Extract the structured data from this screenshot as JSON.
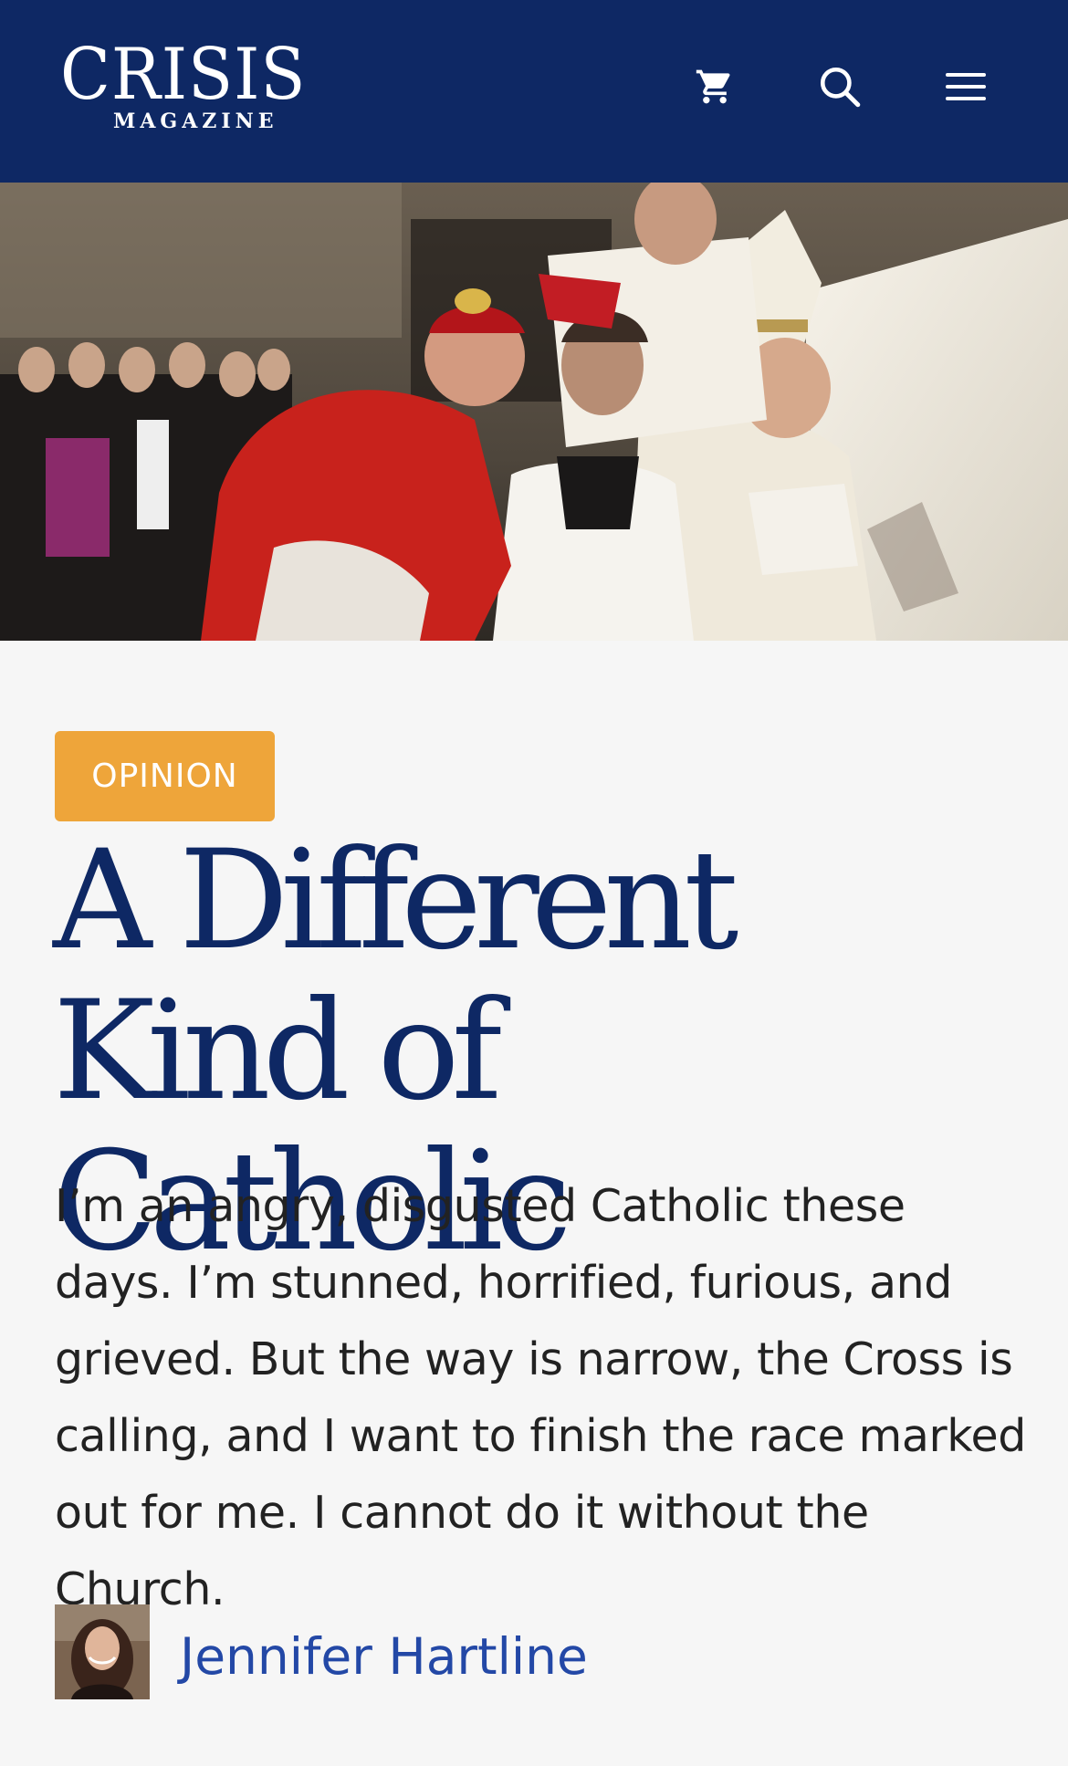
{
  "site": {
    "logo_main": "CRISIS",
    "logo_sub": "MAGAZINE",
    "brand_color": "#0e2864"
  },
  "nav": {
    "icons": [
      "cart-icon",
      "search-icon",
      "menu-icon"
    ]
  },
  "hero": {
    "icon": "hero-image"
  },
  "article": {
    "category": "OPINION",
    "category_color": "#eea53a",
    "title": "A Different Kind of Catholic",
    "excerpt": "I’m an angry, disgusted Catholic these days. I’m stunned, horrified, furious, and grieved. But the way is narrow, the Cross is calling, and I want to finish the race marked out for me. I cannot do it without the Church.",
    "author": "Jennifer Hartline",
    "author_color": "#2348a6"
  }
}
